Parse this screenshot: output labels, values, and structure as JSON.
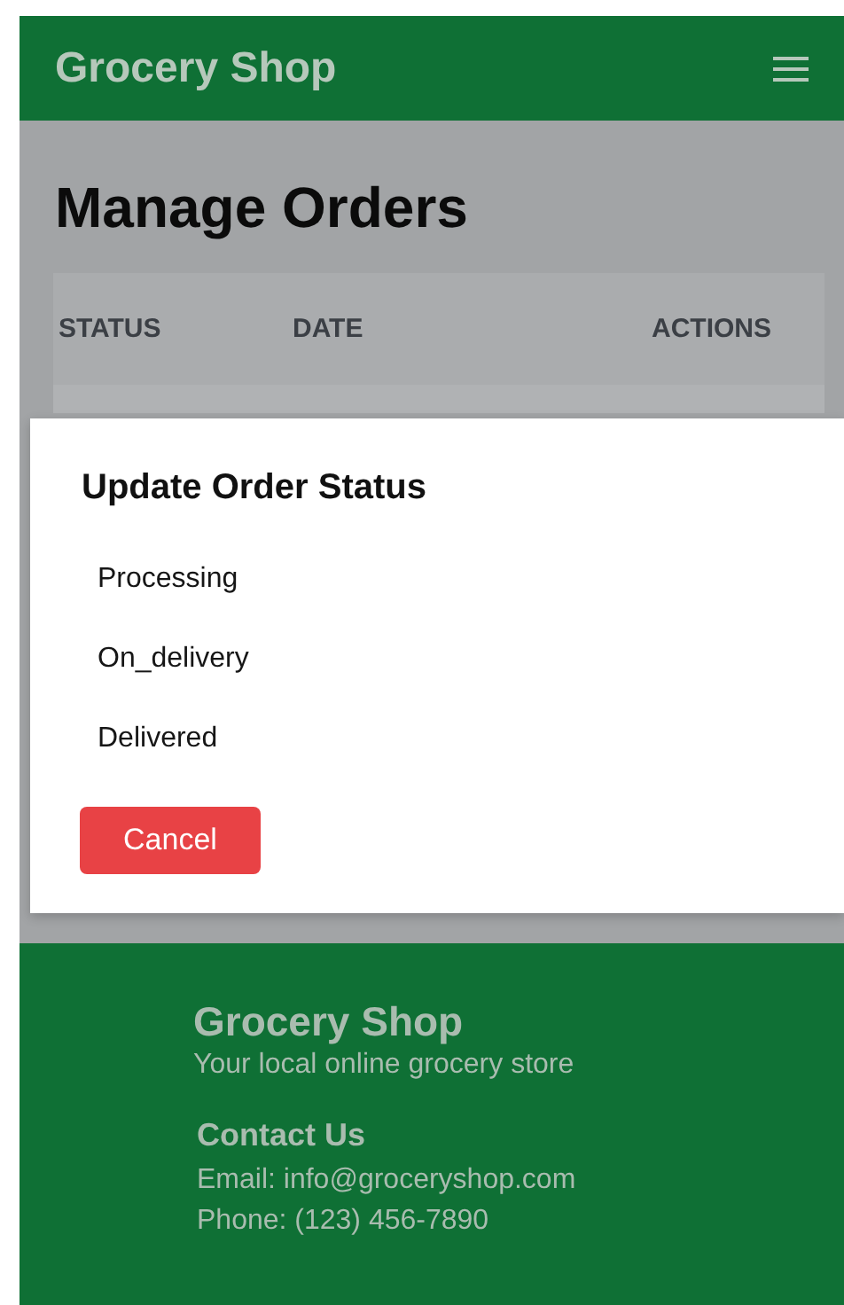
{
  "navbar": {
    "brand": "Grocery Shop"
  },
  "page": {
    "title": "Manage Orders",
    "table": {
      "columns": [
        "STATUS",
        "DATE",
        "ACTIONS"
      ]
    }
  },
  "modal": {
    "title": "Update Order Status",
    "options": [
      "Processing",
      "On_delivery",
      "Delivered"
    ],
    "cancel": "Cancel"
  },
  "footer": {
    "brand": "Grocery Shop",
    "tagline": "Your local online grocery store",
    "contact_title": "Contact Us",
    "lines": [
      "Email: info@groceryshop.com",
      "Phone: (123) 456-7890"
    ]
  }
}
